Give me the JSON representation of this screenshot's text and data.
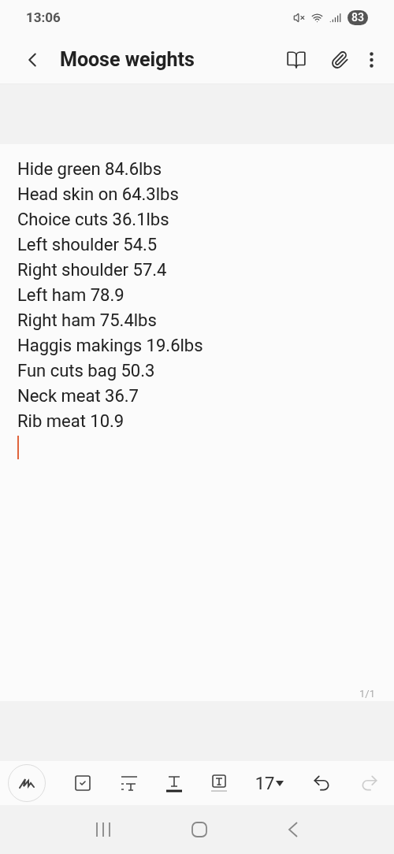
{
  "status_bar": {
    "time": "13:06",
    "battery": "83"
  },
  "header": {
    "title": "Moose weights"
  },
  "note": {
    "lines": [
      "Hide green 84.6lbs",
      "Head skin on 64.3lbs",
      "Choice cuts 36.1lbs",
      "Left shoulder 54.5",
      "Right shoulder 57.4",
      "Left ham 78.9",
      "Right ham 75.4lbs",
      "Haggis makings 19.6lbs",
      "Fun cuts bag 50.3",
      "Neck meat 36.7",
      "Rib meat 10.9"
    ],
    "page": "1/1"
  },
  "toolbar": {
    "font_size": "17",
    "undo_disabled": false,
    "redo_disabled": true
  }
}
